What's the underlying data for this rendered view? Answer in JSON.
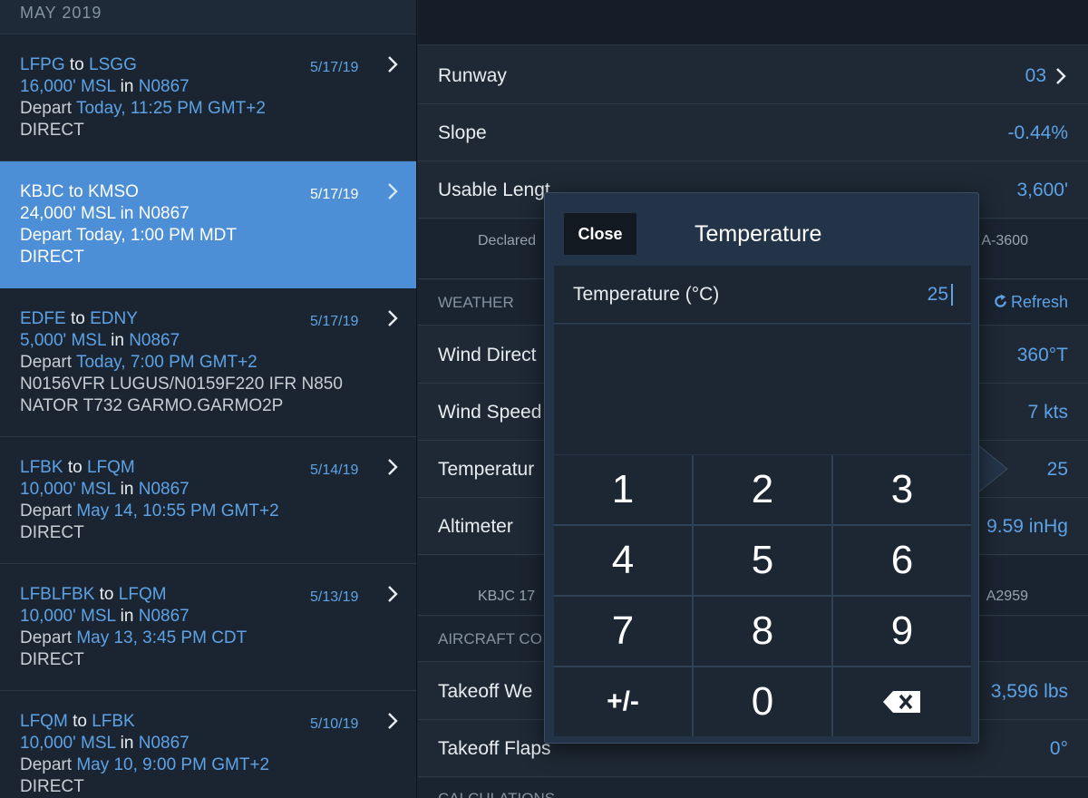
{
  "list": {
    "month_header": "MAY 2019",
    "trips": [
      {
        "from": "LFPG",
        "to": "LSGG",
        "date": "5/17/19",
        "altitude": "16,000' MSL",
        "aircraft": "N0867",
        "depart": "Today, 11:25 PM GMT+2",
        "route": [
          "DIRECT"
        ],
        "selected": false
      },
      {
        "from": "KBJC",
        "to": "KMSO",
        "date": "5/17/19",
        "altitude": "24,000' MSL",
        "aircraft": "N0867",
        "depart": "Today, 1:00 PM MDT",
        "route": [
          "DIRECT"
        ],
        "selected": true
      },
      {
        "from": "EDFE",
        "to": "EDNY",
        "date": "5/17/19",
        "altitude": "5,000' MSL",
        "aircraft": "N0867",
        "depart": "Today, 7:00 PM GMT+2",
        "route": [
          "N0156VFR LUGUS/N0159F220 IFR N850",
          "NATOR T732 GARMO.GARMO2P"
        ],
        "selected": false
      },
      {
        "from": "LFBK",
        "to": "LFQM",
        "date": "5/14/19",
        "altitude": "10,000' MSL",
        "aircraft": "N0867",
        "depart": "May 14, 10:55 PM GMT+2",
        "route": [
          "DIRECT"
        ],
        "selected": false
      },
      {
        "from": "LFBLFBK",
        "to": "LFQM",
        "date": "5/13/19",
        "altitude": "10,000' MSL",
        "aircraft": "N0867",
        "depart": "May 13, 3:45 PM CDT",
        "route": [
          "DIRECT"
        ],
        "selected": false
      },
      {
        "from": "LFQM",
        "to": "LFBK",
        "date": "5/10/19",
        "altitude": "10,000' MSL",
        "aircraft": "N0867",
        "depart": "May 10, 9:00 PM GMT+2",
        "route": [
          "DIRECT"
        ],
        "selected": false
      }
    ],
    "word_to": "to",
    "word_in": "in",
    "word_depart": "Depart"
  },
  "detail": {
    "runway": {
      "label": "Runway",
      "value": "03"
    },
    "slope": {
      "label": "Slope",
      "value": "-0.44%"
    },
    "usable_length": {
      "label": "Usable Lengt",
      "value": "3,600'"
    },
    "declared_note": {
      "left": "Declared",
      "right": "A-3600"
    },
    "weather_header": "WEATHER",
    "refresh_label": "Refresh",
    "wind_direction": {
      "label": "Wind Direct",
      "value": "360°T"
    },
    "wind_speed": {
      "label": "Wind Speed",
      "value": "7 kts"
    },
    "temperature": {
      "label": "Temperatur",
      "value": "25"
    },
    "altimeter": {
      "label": "Altimeter",
      "value": "9.59 inHg"
    },
    "metar_note": {
      "left": "KBJC 17",
      "right": "A2959"
    },
    "aircraft_header": "AIRCRAFT CO",
    "takeoff_weight": {
      "label": "Takeoff We",
      "value": "3,596 lbs"
    },
    "takeoff_flaps": {
      "label": "Takeoff Flaps",
      "value": "0°"
    },
    "calculations_header": "CALCULATIONS"
  },
  "popover": {
    "close_label": "Close",
    "title": "Temperature",
    "field_label": "Temperature (°C)",
    "field_value": "25",
    "keys": [
      "1",
      "2",
      "3",
      "4",
      "5",
      "6",
      "7",
      "8",
      "9",
      "+/-",
      "0"
    ]
  },
  "colors": {
    "accent": "#5ea2e6",
    "selected_row": "#4c8fd6",
    "background": "#1b2632"
  }
}
